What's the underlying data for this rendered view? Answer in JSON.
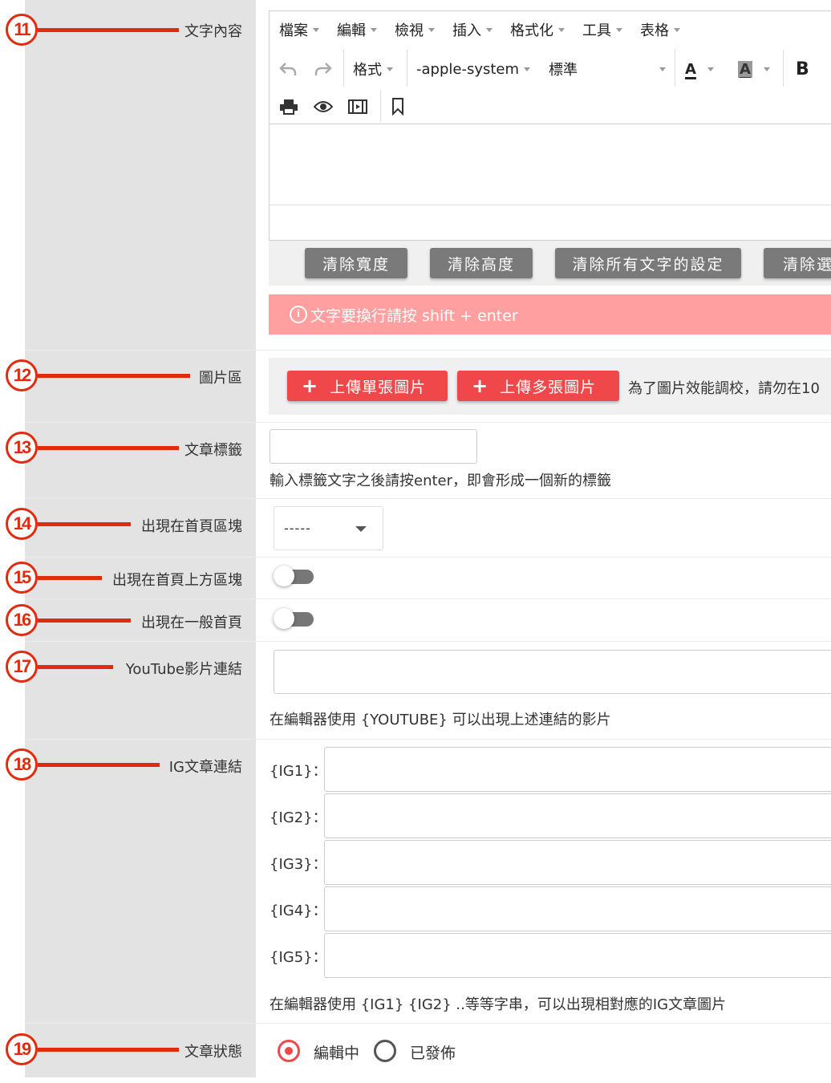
{
  "rows": {
    "r11": {
      "num": "11",
      "label": "文字內容"
    },
    "r12": {
      "num": "12",
      "label": "圖片區"
    },
    "r13": {
      "num": "13",
      "label": "文章標籤"
    },
    "r14": {
      "num": "14",
      "label": "出現在首頁區塊"
    },
    "r15": {
      "num": "15",
      "label": "出現在首頁上方區塊"
    },
    "r16": {
      "num": "16",
      "label": "出現在一般首頁"
    },
    "r17": {
      "num": "17",
      "label": "YouTube影片連結"
    },
    "r18": {
      "num": "18",
      "label": "IG文章連結"
    },
    "r19": {
      "num": "19",
      "label": "文章狀態"
    }
  },
  "editor": {
    "menu": [
      "檔案",
      "編輯",
      "檢視",
      "插入",
      "格式化",
      "工具",
      "表格"
    ],
    "format_label": "格式",
    "font_family": "-apple-system",
    "font_size": "標準",
    "text_color_glyph": "A",
    "bg_color_glyph": "A",
    "bold_glyph": "B"
  },
  "buttons": {
    "clear_width": "清除寬度",
    "clear_height": "清除高度",
    "clear_all_text": "清除所有文字的設定",
    "clear_selected": "清除選"
  },
  "alert": {
    "text": "文字要換行請按 shift + enter"
  },
  "images": {
    "upload_single": "上傳單張圖片",
    "upload_multi": "上傳多張圖片",
    "note": "為了圖片效能調校，請勿在10"
  },
  "tags": {
    "help": "輸入標籤文字之後請按enter，即會形成一個新的標籤",
    "value": ""
  },
  "home_block": {
    "selected": "-----"
  },
  "toggles": {
    "home_top": false,
    "general_home": false
  },
  "youtube": {
    "value": "",
    "help": "在編輯器使用 {YOUTUBE} 可以出現上述連結的影片"
  },
  "ig": {
    "labels": [
      "{IG1}：",
      "{IG2}：",
      "{IG3}：",
      "{IG4}：",
      "{IG5}："
    ],
    "help": "在編輯器使用 {IG1} {IG2} ..等等字串，可以出現相對應的IG文章圖片"
  },
  "status": {
    "options": [
      "編輯中",
      "已發佈"
    ],
    "selected": "編輯中"
  },
  "colors": {
    "marker": "#e02b0e",
    "primary_red": "#f0484a",
    "alert_bg": "#ff9f9f",
    "gray_button": "#7a7a7a"
  }
}
